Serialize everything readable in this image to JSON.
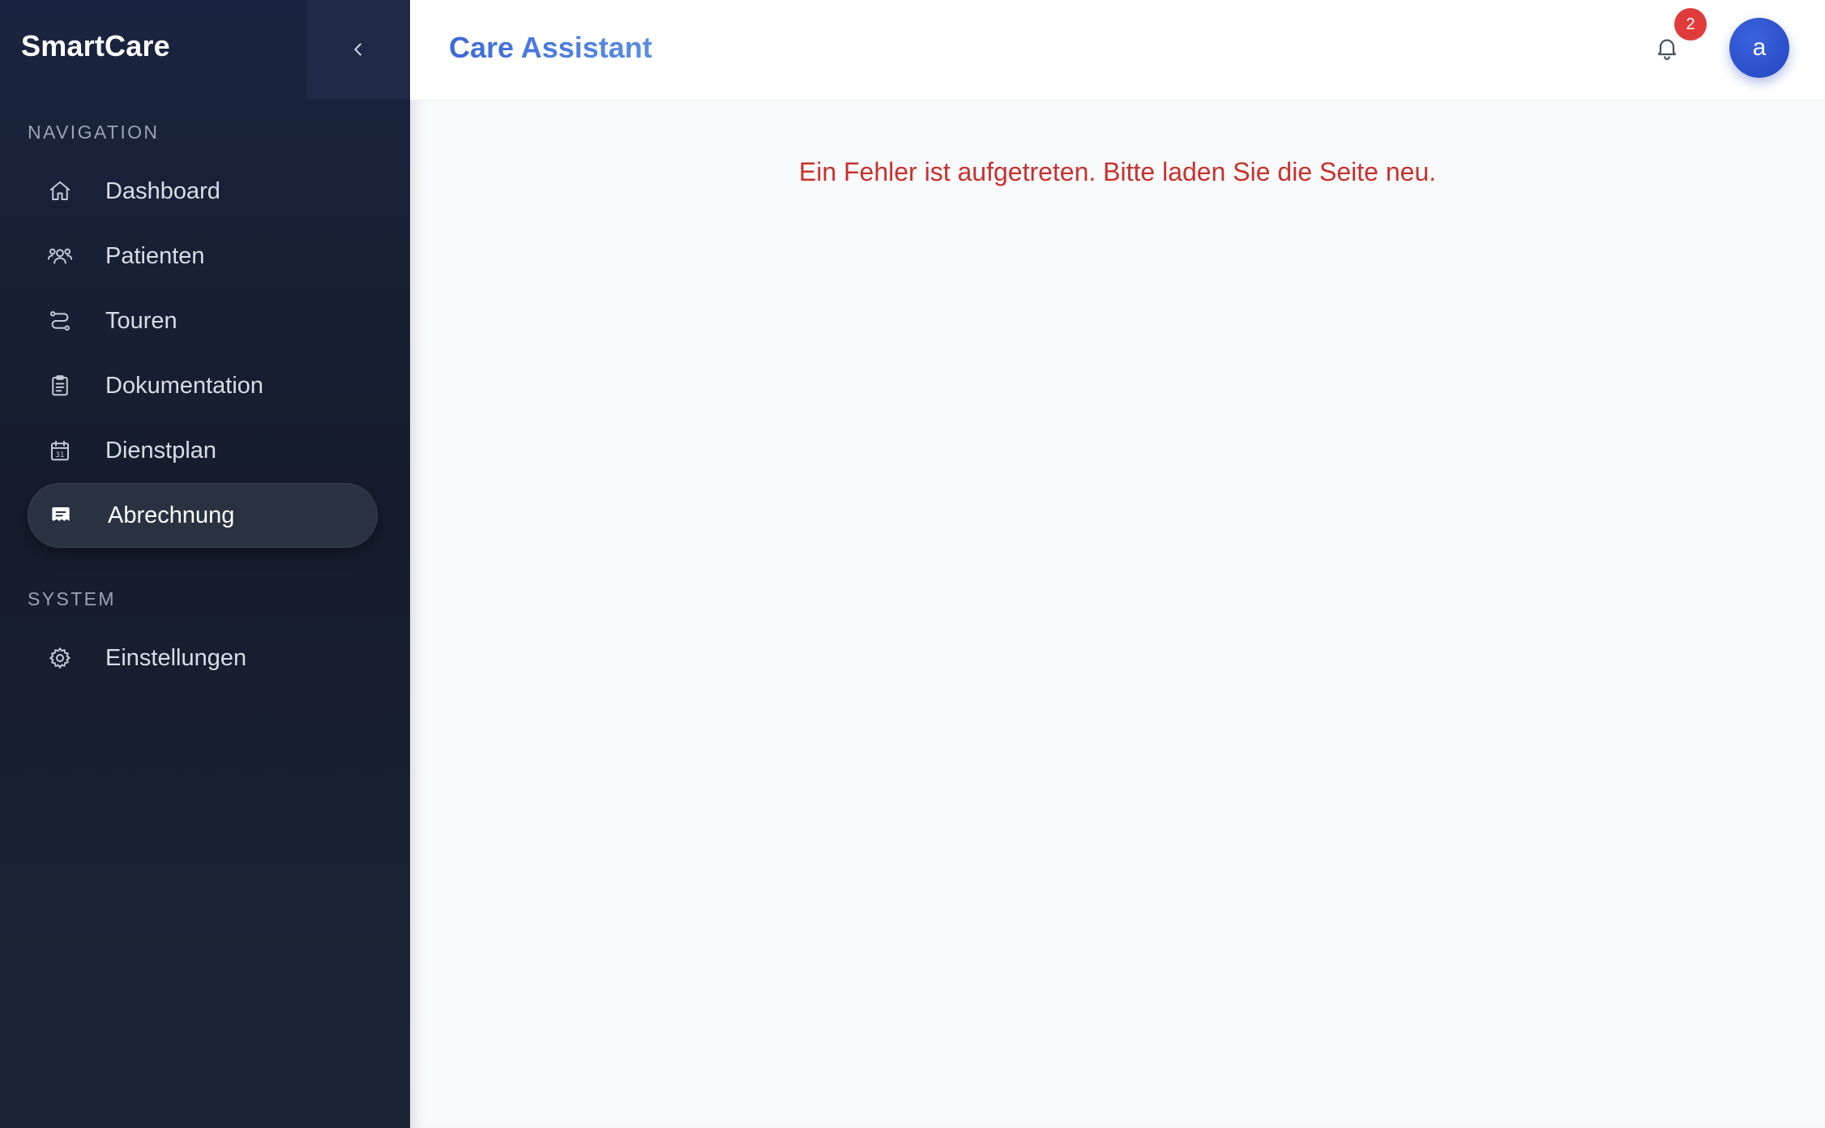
{
  "sidebar": {
    "brand": "SmartCare",
    "navigation_heading": "NAVIGATION",
    "nav_items": [
      {
        "label": "Dashboard",
        "icon": "home-icon"
      },
      {
        "label": "Patienten",
        "icon": "users-icon"
      },
      {
        "label": "Touren",
        "icon": "route-icon"
      },
      {
        "label": "Dokumentation",
        "icon": "clipboard-icon"
      },
      {
        "label": "Dienstplan",
        "icon": "calendar-icon"
      },
      {
        "label": "Abrechnung",
        "icon": "invoice-icon",
        "active": true
      }
    ],
    "system_heading": "SYSTEM",
    "system_items": [
      {
        "label": "Einstellungen",
        "icon": "gear-icon"
      }
    ]
  },
  "header": {
    "title": "Care Assistant",
    "notification_count": "2",
    "avatar_initial": "a"
  },
  "main": {
    "error_message": "Ein Fehler ist aufgetreten. Bitte laden Sie die Seite neu."
  },
  "colors": {
    "sidebar_bg": "#161c2c",
    "accent_blue": "#3c6ad6",
    "error_red": "#c8312c",
    "badge_red": "#e03b3b",
    "avatar_blue": "#2446c0"
  }
}
